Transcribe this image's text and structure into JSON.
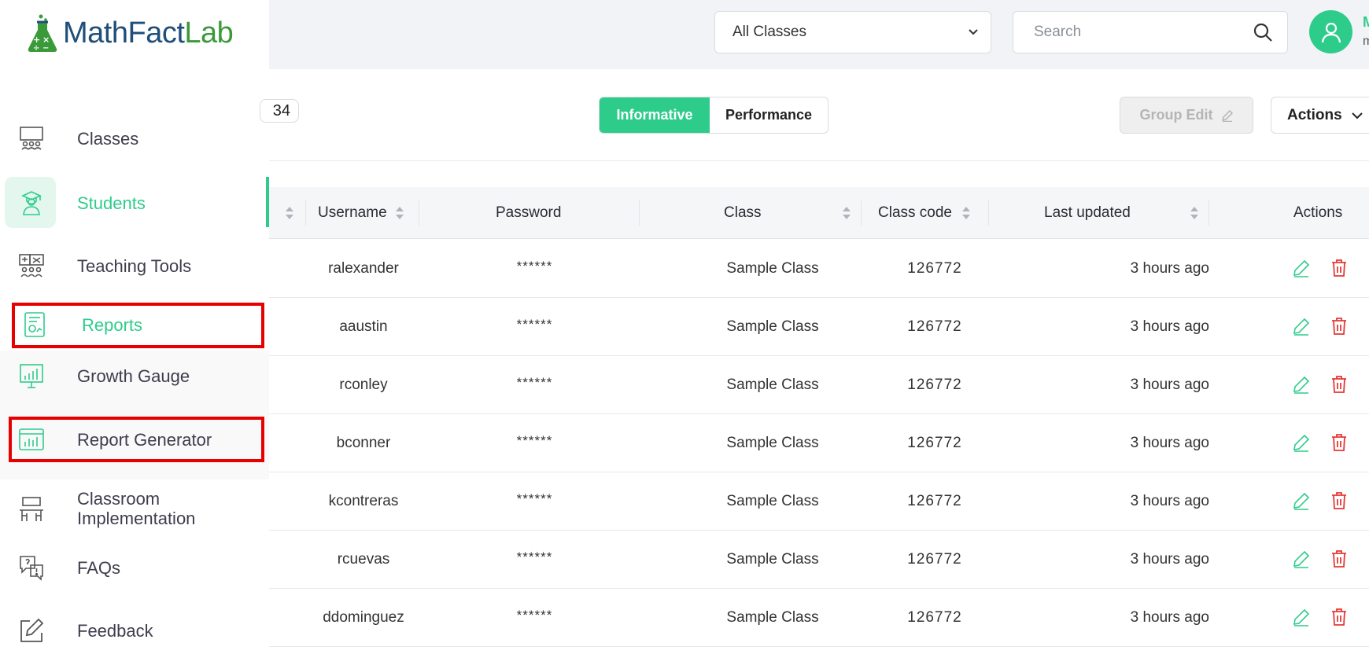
{
  "brand": {
    "name_part1": "MathFact",
    "name_part2": "Lab"
  },
  "sidebar": {
    "items": [
      {
        "label": "Classes"
      },
      {
        "label": "Students"
      },
      {
        "label": "Teaching Tools"
      },
      {
        "label": "Reports"
      },
      {
        "label": "Growth Gauge"
      },
      {
        "label": "Report Generator"
      },
      {
        "label": "Classroom Implementation"
      },
      {
        "label": "FAQs"
      },
      {
        "label": "Feedback"
      }
    ]
  },
  "header": {
    "class_select": "All Classes",
    "search_placeholder": "Search",
    "user_initial": "M",
    "user_sub": "m"
  },
  "toolbar": {
    "count": "34",
    "view_informative": "Informative",
    "view_performance": "Performance",
    "group_edit": "Group Edit",
    "actions": "Actions"
  },
  "table": {
    "columns": [
      "Username",
      "Password",
      "Class",
      "Class code",
      "Last updated",
      "Actions"
    ],
    "rows": [
      {
        "username": "ralexander",
        "password": "******",
        "class": "Sample Class",
        "code": "126772",
        "updated": "3 hours ago"
      },
      {
        "username": "aaustin",
        "password": "******",
        "class": "Sample Class",
        "code": "126772",
        "updated": "3 hours ago"
      },
      {
        "username": "rconley",
        "password": "******",
        "class": "Sample Class",
        "code": "126772",
        "updated": "3 hours ago"
      },
      {
        "username": "bconner",
        "password": "******",
        "class": "Sample Class",
        "code": "126772",
        "updated": "3 hours ago"
      },
      {
        "username": "kcontreras",
        "password": "******",
        "class": "Sample Class",
        "code": "126772",
        "updated": "3 hours ago"
      },
      {
        "username": "rcuevas",
        "password": "******",
        "class": "Sample Class",
        "code": "126772",
        "updated": "3 hours ago"
      },
      {
        "username": "ddominguez",
        "password": "******",
        "class": "Sample Class",
        "code": "126772",
        "updated": "3 hours ago"
      }
    ]
  },
  "colors": {
    "accent": "#2ecc8b",
    "highlight": "#e60000",
    "delete": "#e53935"
  }
}
